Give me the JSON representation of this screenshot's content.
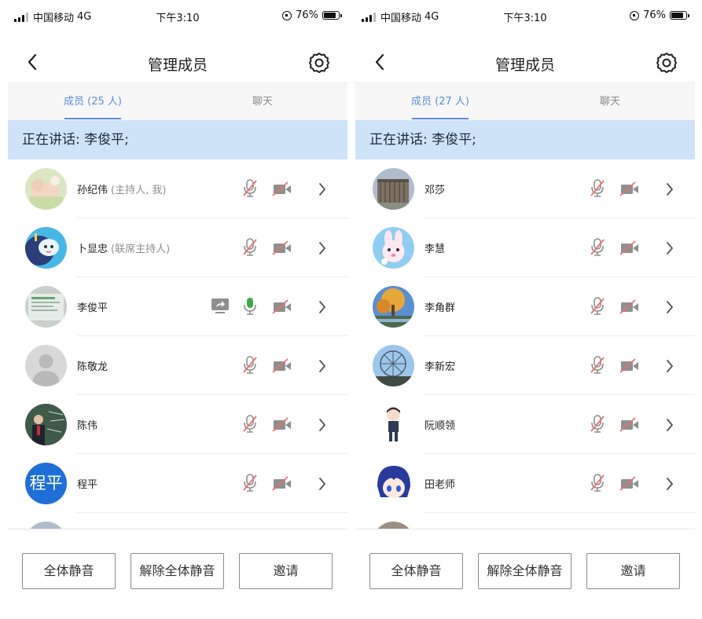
{
  "panels": [
    {
      "status": {
        "carrier": "中国移动",
        "network": "4G",
        "time": "下午3:10",
        "battery": "76%"
      },
      "header": {
        "title": "管理成员"
      },
      "tabs": [
        {
          "label": "成员 (25 人)",
          "active": true
        },
        {
          "label": "聊天",
          "active": false
        }
      ],
      "speaking": "正在讲话: 李俊平;",
      "members": [
        {
          "name": "孙纪伟",
          "role": "(主持人, 我)",
          "avatar": "photo-baby",
          "mic": "muted",
          "cam": "off",
          "share": false
        },
        {
          "name": "卜显忠",
          "role": "(联席主持人)",
          "avatar": "cartoon-blue",
          "mic": "muted",
          "cam": "off",
          "share": false
        },
        {
          "name": "李俊平",
          "role": "",
          "avatar": "photo-screen",
          "mic": "on",
          "cam": "off",
          "share": true
        },
        {
          "name": "陈敬龙",
          "role": "",
          "avatar": "default-person",
          "mic": "muted",
          "cam": "off",
          "share": false
        },
        {
          "name": "陈伟",
          "role": "",
          "avatar": "photo-teacher",
          "mic": "muted",
          "cam": "off",
          "share": false
        },
        {
          "name": "程平",
          "role": "",
          "avatar": "text",
          "avatar_text": "程平",
          "mic": "muted",
          "cam": "off",
          "share": false
        },
        {
          "name": "",
          "role": "",
          "avatar": "photo-building",
          "mic": "muted",
          "cam": "off",
          "share": false
        }
      ],
      "buttons": {
        "mute_all": "全体静音",
        "unmute_all": "解除全体静音",
        "invite": "邀请"
      }
    },
    {
      "status": {
        "carrier": "中国移动",
        "network": "4G",
        "time": "下午3:10",
        "battery": "76%"
      },
      "header": {
        "title": "管理成员"
      },
      "tabs": [
        {
          "label": "成员 (27 人)",
          "active": true
        },
        {
          "label": "聊天",
          "active": false
        }
      ],
      "speaking": "正在讲话: 李俊平;",
      "members": [
        {
          "name": "邓莎",
          "role": "",
          "avatar": "photo-building",
          "mic": "muted",
          "cam": "off",
          "share": false
        },
        {
          "name": "李慧",
          "role": "",
          "avatar": "cartoon-bunny",
          "mic": "muted",
          "cam": "off",
          "share": false
        },
        {
          "name": "李角群",
          "role": "",
          "avatar": "photo-tree",
          "mic": "muted",
          "cam": "off",
          "share": false
        },
        {
          "name": "李新宏",
          "role": "",
          "avatar": "photo-wheel",
          "mic": "muted",
          "cam": "off",
          "share": false
        },
        {
          "name": "阮顺领",
          "role": "",
          "avatar": "cartoon-boy",
          "mic": "muted",
          "cam": "off",
          "share": false
        },
        {
          "name": "田老师",
          "role": "",
          "avatar": "cartoon-anime",
          "mic": "muted",
          "cam": "off",
          "share": false
        },
        {
          "name": "",
          "role": "",
          "avatar": "photo-person",
          "mic": "muted",
          "cam": "off",
          "share": false
        }
      ],
      "buttons": {
        "mute_all": "全体静音",
        "unmute_all": "解除全体静音",
        "invite": "邀请"
      }
    }
  ],
  "colors": {
    "accent": "#5b8edb",
    "speaking_bg": "#cfe3f8",
    "muted_red": "#e4736f",
    "mic_on": "#3faa4a",
    "icon_gray": "#8f8f8f"
  }
}
